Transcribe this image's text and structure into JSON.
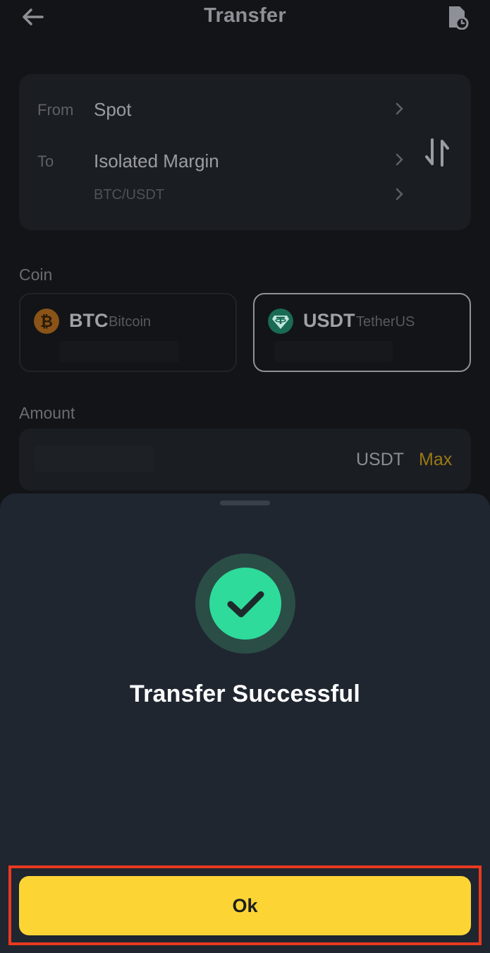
{
  "header": {
    "title": "Transfer",
    "back_icon": "arrow-left-icon",
    "history_icon": "document-clock-icon"
  },
  "transfer": {
    "from_label": "From",
    "from_value": "Spot",
    "to_label": "To",
    "to_value": "Isolated Margin",
    "pair": "BTC/USDT",
    "swap_icon": "swap-vertical-icon"
  },
  "coin": {
    "label": "Coin",
    "options": [
      {
        "symbol": "BTC",
        "name": "Bitcoin",
        "icon": "bitcoin-icon",
        "color": "#f7931a",
        "selected": false
      },
      {
        "symbol": "USDT",
        "name": "TetherUS",
        "icon": "tether-icon",
        "color": "#26a17b",
        "selected": true
      }
    ]
  },
  "amount": {
    "label": "Amount",
    "unit": "USDT",
    "max_label": "Max"
  },
  "sheet": {
    "status_icon": "checkmark-circle-icon",
    "message": "Transfer Successful",
    "ok_label": "Ok"
  },
  "colors": {
    "accent": "#fcd535",
    "success": "#2edb9b",
    "highlight": "#e8391f"
  }
}
